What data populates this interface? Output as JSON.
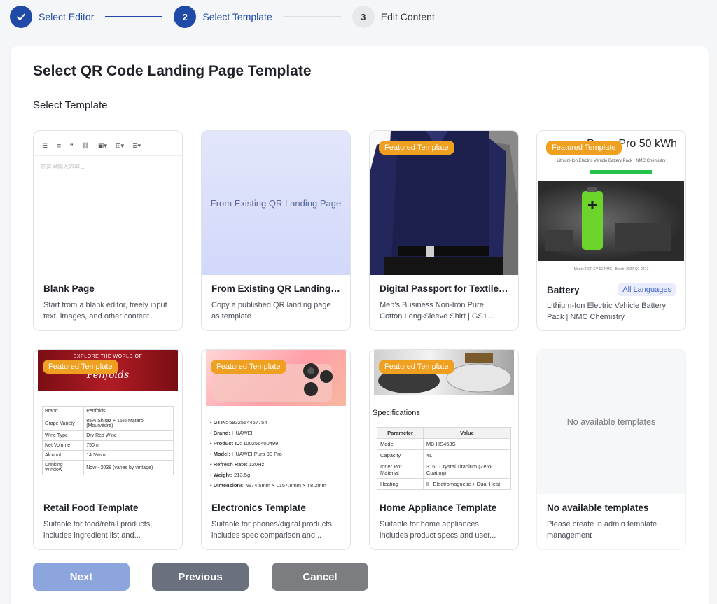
{
  "stepper": {
    "steps": [
      {
        "label": "Select Editor",
        "number": "1",
        "state": "done"
      },
      {
        "label": "Select Template",
        "number": "2",
        "state": "active"
      },
      {
        "label": "Edit Content",
        "number": "3",
        "state": "todo"
      }
    ]
  },
  "panel": {
    "title": "Select QR Code Landing Page Template",
    "section_label": "Select Template"
  },
  "badge_text": "Featured Template",
  "templates": [
    {
      "name": "Blank Page",
      "desc": "Start from a blank editor, freely input text, images, and other content",
      "placeholder": "在这里输入内容..."
    },
    {
      "name": "From Existing QR Landing P...",
      "desc": "Copy a published QR landing page as template",
      "thumb_text": "From Existing QR Landing Page"
    },
    {
      "name": "Digital Passport for Textile ...",
      "desc": "Men's Business Non-Iron Pure Cotton Long-Sleeve Shirt | GS1 Unique ID:..."
    },
    {
      "name": "Battery",
      "desc": "Lithium-Ion Electric Vehicle Battery Pack | NMC Chemistry",
      "lang": "All Languages",
      "thumb_title": "PowerPro 50 kWh",
      "thumb_sub": "Lithium-Ion Electric Vehicle Battery Pack · NMC Chemistry",
      "thumb_foot": "Model: PEF-EV-50-NMC · Batch: 2027-Q1-0412"
    },
    {
      "name": "Retail Food Template",
      "desc": "Suitable for food/retail products, includes ingredient list and...",
      "thumb_cap": "EXPLORE THE WORLD OF",
      "thumb_script": "Penfolds",
      "rows": [
        [
          "Brand",
          "Penfolds"
        ],
        [
          "Grape Variety",
          "85% Shiraz + 15% Mataro (Mourvèdre)"
        ],
        [
          "Wine Type",
          "Dry Red Wine"
        ],
        [
          "Net Volume",
          "750ml"
        ],
        [
          "Alcohol",
          "14.5%vol"
        ],
        [
          "Drinking Window",
          "Now - 2038 (varies by vintage)"
        ]
      ]
    },
    {
      "name": "Electronics Template",
      "desc": "Suitable for phones/digital products, includes spec comparison and...",
      "specs": [
        [
          "GTIN:",
          "6932554457754"
        ],
        [
          "Brand:",
          "HUAWEI"
        ],
        [
          "Product ID:",
          "100256400499"
        ],
        [
          "Model:",
          "HUAWEI Pura 90 Pro"
        ],
        [
          "Refresh Rate:",
          "120Hz"
        ],
        [
          "Weight:",
          "213.5g"
        ],
        [
          "Dimensions:",
          "W74.5mm × L157.8mm × T8.2mm"
        ]
      ]
    },
    {
      "name": "Home Appliance Template",
      "desc": "Suitable for home appliances, includes product specs and user...",
      "spec_title": "Specifications",
      "headers": [
        "Parameter",
        "Value"
      ],
      "rows": [
        [
          "Model",
          "MB-HS453S"
        ],
        [
          "Capacity",
          "4L"
        ],
        [
          "Inner Pot Material",
          "316L Crystal Titanium (Zero-Coating)"
        ],
        [
          "Heating",
          "IH Electromagnetic + Dual Heat"
        ]
      ]
    },
    {
      "name": "No available templates",
      "desc": "Please create in admin template management",
      "thumb_text": "No available templates"
    }
  ],
  "buttons": {
    "next": "Next",
    "previous": "Previous",
    "cancel": "Cancel"
  }
}
